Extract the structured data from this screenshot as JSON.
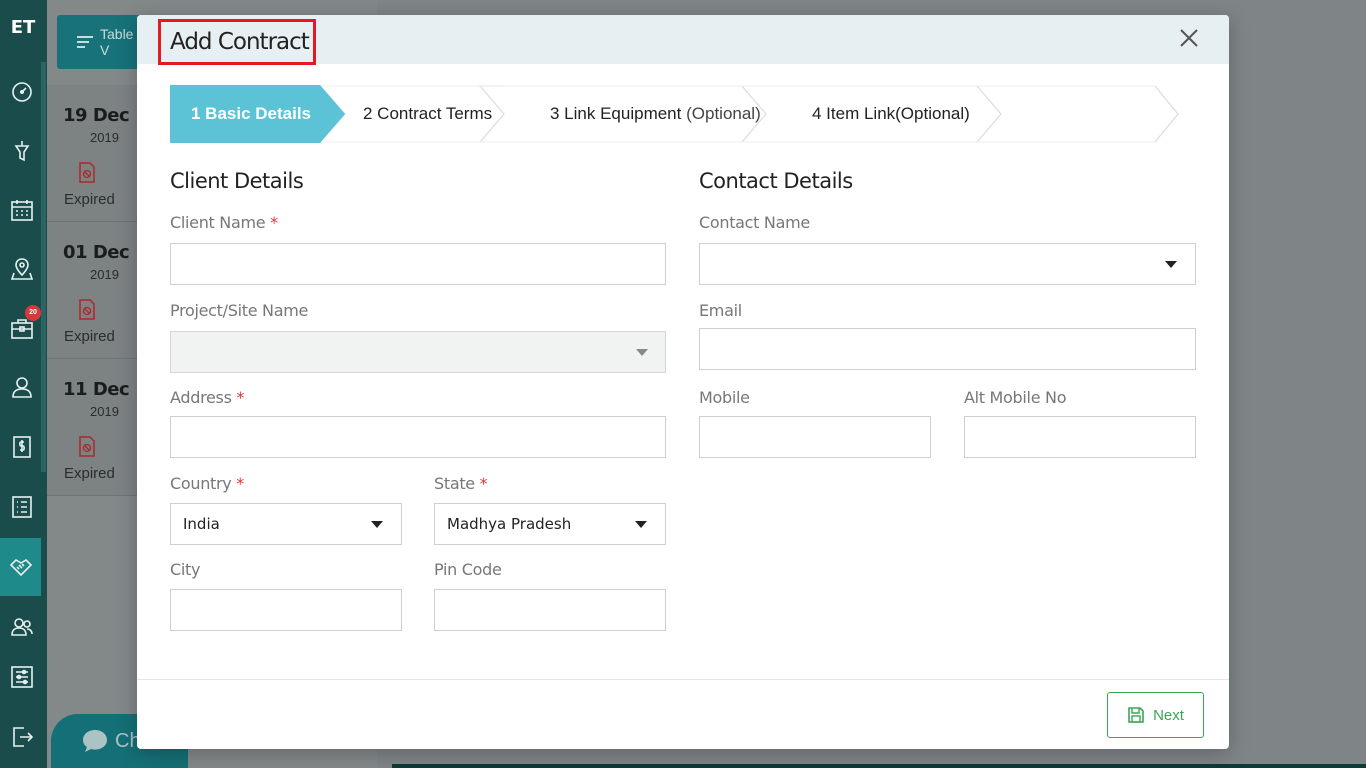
{
  "app": {
    "logo_text": "ET",
    "notification_count": "20"
  },
  "background": {
    "table_view_label": "Table V",
    "chat_label": "Ch",
    "cards": [
      {
        "day": "19 Dec",
        "year": "2019",
        "status": "Expired"
      },
      {
        "day": "01 Dec",
        "year": "2019",
        "status": "Expired"
      },
      {
        "day": "11 Dec",
        "year": "2019",
        "status": "Expired"
      }
    ]
  },
  "modal": {
    "title": "Add Contract",
    "steps": [
      {
        "label": "1 Basic Details",
        "optional": ""
      },
      {
        "label": "2 Contract Terms",
        "optional": ""
      },
      {
        "label": "3 Link Equipment ",
        "optional": "(Optional)"
      },
      {
        "label": "4 Item Link(Optional)",
        "optional": ""
      }
    ],
    "client": {
      "heading": "Client Details",
      "client_name_label": "Client Name",
      "client_name_value": "",
      "project_label": "Project/Site Name",
      "project_value": "",
      "address_label": "Address",
      "address_value": "",
      "country_label": "Country",
      "country_value": "India",
      "state_label": "State",
      "state_value": "Madhya Pradesh",
      "city_label": "City",
      "city_value": "",
      "pin_label": "Pin Code",
      "pin_value": ""
    },
    "contact": {
      "heading": "Contact Details",
      "contact_name_label": "Contact Name",
      "contact_name_value": "",
      "email_label": "Email",
      "email_value": "",
      "mobile_label": "Mobile",
      "mobile_value": "",
      "alt_mobile_label": "Alt Mobile No",
      "alt_mobile_value": ""
    },
    "required_mark": "*",
    "next_label": "Next"
  },
  "colors": {
    "sidebar": "#1b4c4c",
    "accent": "#5bc3d5",
    "required": "#e0363c",
    "next": "#3aa655",
    "title_highlight": "#e51921"
  }
}
